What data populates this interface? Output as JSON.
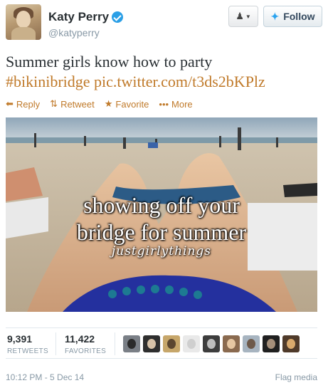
{
  "user": {
    "fullname": "Katy Perry",
    "username": "@katyperry",
    "avatar_icon": "profile-photo",
    "verified_icon": "verified-badge-icon"
  },
  "buttons": {
    "user_actions_icon": "user-dropdown-icon",
    "follow_label": "Follow",
    "follow_icon": "twitter-bird-icon"
  },
  "tweet": {
    "text": "Summer girls know how to party",
    "hashtag": "#bikinibridge",
    "link": "pic.twitter.com/t3ds2bKPlz"
  },
  "actions": [
    {
      "label": "Reply",
      "icon": "reply-icon"
    },
    {
      "label": "Retweet",
      "icon": "retweet-icon"
    },
    {
      "label": "Favorite",
      "icon": "star-icon"
    },
    {
      "label": "More",
      "icon": "more-dots-icon"
    }
  ],
  "media": {
    "caption_line1": "showing off your",
    "caption_line2": "bridge for summer",
    "caption_script": "justgirlythings"
  },
  "stats": {
    "retweets_count": "9,391",
    "retweets_label": "RETWEETS",
    "favorites_count": "11,422",
    "favorites_label": "FAVORITES"
  },
  "favoriters": [
    {
      "bg": "#7a7f86",
      "fg": "#2b2b2b"
    },
    {
      "bg": "#2e2e2e",
      "fg": "#d7c2a8"
    },
    {
      "bg": "#c6a66a",
      "fg": "#5b4630"
    },
    {
      "bg": "#e9e9e9",
      "fg": "#cfcfcf"
    },
    {
      "bg": "#3d3d3d",
      "fg": "#bdbdbd"
    },
    {
      "bg": "#8a6a4f",
      "fg": "#e6c7a3"
    },
    {
      "bg": "#a7b4c0",
      "fg": "#6e5a4b"
    },
    {
      "bg": "#202020",
      "fg": "#a58f7a"
    },
    {
      "bg": "#4f3a2a",
      "fg": "#d9a96c"
    }
  ],
  "footer": {
    "timestamp": "10:12 PM - 5 Dec 14",
    "flag_label": "Flag media"
  },
  "colors": {
    "accent": "#c07a2a",
    "verified": "#2b9fe6",
    "muted": "#8899a6"
  }
}
